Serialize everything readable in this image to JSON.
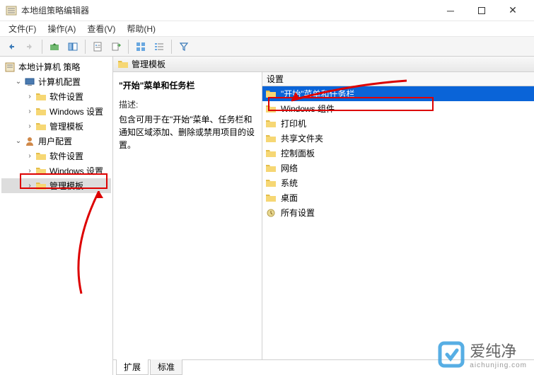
{
  "window": {
    "title": "本地组策略编辑器"
  },
  "menu": {
    "file": "文件(F)",
    "action": "操作(A)",
    "view": "查看(V)",
    "help": "帮助(H)"
  },
  "tree": {
    "root": "本地计算机 策略",
    "computer": "计算机配置",
    "cSoft": "软件设置",
    "cWin": "Windows 设置",
    "cAdmin": "管理模板",
    "user": "用户配置",
    "uSoft": "软件设置",
    "uWin": "Windows 设置",
    "uAdmin": "管理模板"
  },
  "content": {
    "header": "管理模板",
    "title": "\"开始\"菜单和任务栏",
    "descLabel": "描述:",
    "desc": "包含可用于在\"开始\"菜单、任务栏和通知区域添加、删除或禁用项目的设置。"
  },
  "list": {
    "header": "设置",
    "items": [
      "\"开始\"菜单和任务栏",
      "Windows 组件",
      "打印机",
      "共享文件夹",
      "控制面板",
      "网络",
      "系统",
      "桌面",
      "所有设置"
    ]
  },
  "tabs": {
    "ext": "扩展",
    "std": "标准"
  },
  "watermark": {
    "text": "爱纯净",
    "url": "aichunjing.com"
  }
}
